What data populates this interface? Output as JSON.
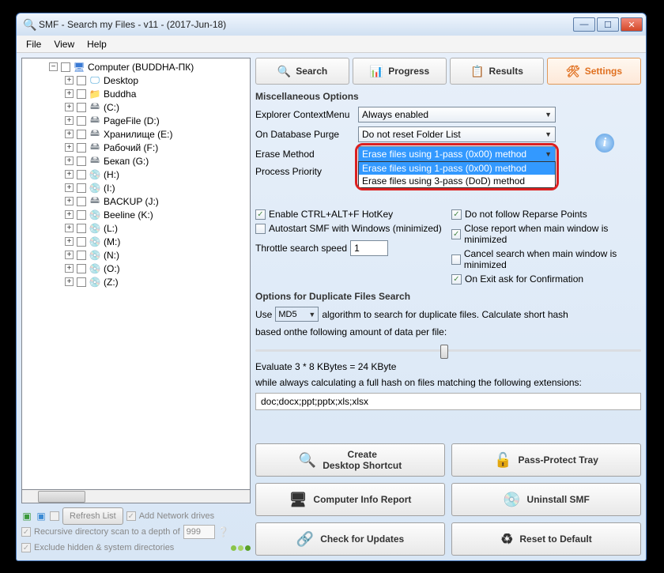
{
  "window": {
    "title": "SMF - Search my Files - v11 - (2017-Jun-18)"
  },
  "menubar": [
    "File",
    "View",
    "Help"
  ],
  "tree": {
    "root": "Computer (BUDDHA-ПК)",
    "items": [
      {
        "label": "Desktop",
        "icon": "desk"
      },
      {
        "label": "Buddha",
        "icon": "fold"
      },
      {
        "label": "(C:)",
        "icon": "hdd"
      },
      {
        "label": "PageFile (D:)",
        "icon": "hdd"
      },
      {
        "label": "Хранилище (E:)",
        "icon": "hdd"
      },
      {
        "label": "Рабочий (F:)",
        "icon": "hdd"
      },
      {
        "label": "Бекап (G:)",
        "icon": "hdd"
      },
      {
        "label": "(H:)",
        "icon": "cd"
      },
      {
        "label": "(I:)",
        "icon": "cd"
      },
      {
        "label": "BACKUP (J:)",
        "icon": "hdd"
      },
      {
        "label": "Beeline (K:)",
        "icon": "cd"
      },
      {
        "label": "(L:)",
        "icon": "cd"
      },
      {
        "label": "(M:)",
        "icon": "cd"
      },
      {
        "label": "(N:)",
        "icon": "cd"
      },
      {
        "label": "(O:)",
        "icon": "cd"
      },
      {
        "label": "(Z:)",
        "icon": "cd"
      }
    ]
  },
  "leftBottom": {
    "refresh": "Refresh List",
    "addNet": "Add Network drives",
    "recursive": "Recursive directory scan to a depth of",
    "depth": "999",
    "exclude": "Exclude hidden & system directories"
  },
  "tabs": {
    "search": "Search",
    "progress": "Progress",
    "results": "Results",
    "settings": "Settings"
  },
  "misc": {
    "title": "Miscellaneous Options",
    "ctxLabel": "Explorer ContextMenu",
    "ctxValue": "Always enabled",
    "purgeLabel": "On Database Purge",
    "purgeValue": "Do not reset Folder List",
    "eraseLabel": "Erase Method",
    "eraseValue": "Erase files using 1-pass (0x00) method",
    "eraseOptions": [
      "Erase files using 1-pass (0x00) method",
      "Erase files using 3-pass (DoD) method"
    ],
    "prioLabel": "Process Priority",
    "chkHotkey": "Enable CTRL+ALT+F HotKey",
    "chkAutostart": "Autostart SMF with Windows (minimized)",
    "throttleLabel": "Throttle search speed",
    "throttleValue": "1",
    "chkReparse": "Do not follow Reparse Points",
    "chkCloseReport": "Close report when main window is minimized",
    "chkCancelSearch": "Cancel search when main window is minimized",
    "chkExitConfirm": "On Exit ask for Confirmation"
  },
  "dup": {
    "title": "Options for Duplicate Files Search",
    "usePrefix": "Use",
    "algo": "MD5",
    "useSuffix": "algorithm to search for duplicate files. Calculate short hash",
    "based": "based onthe following amount of data per file:",
    "eval": "Evaluate 3 * 8 KBytes = 24 KByte",
    "while": "while always calculating a full hash on files matching the following extensions:",
    "ext": "doc;docx;ppt;pptx;xls;xlsx"
  },
  "buttons": {
    "shortcut": "Create\nDesktop Shortcut",
    "passProtect": "Pass-Protect Tray",
    "compInfo": "Computer Info Report",
    "uninstall": "Uninstall SMF",
    "updates": "Check for Updates",
    "reset": "Reset to Default"
  }
}
